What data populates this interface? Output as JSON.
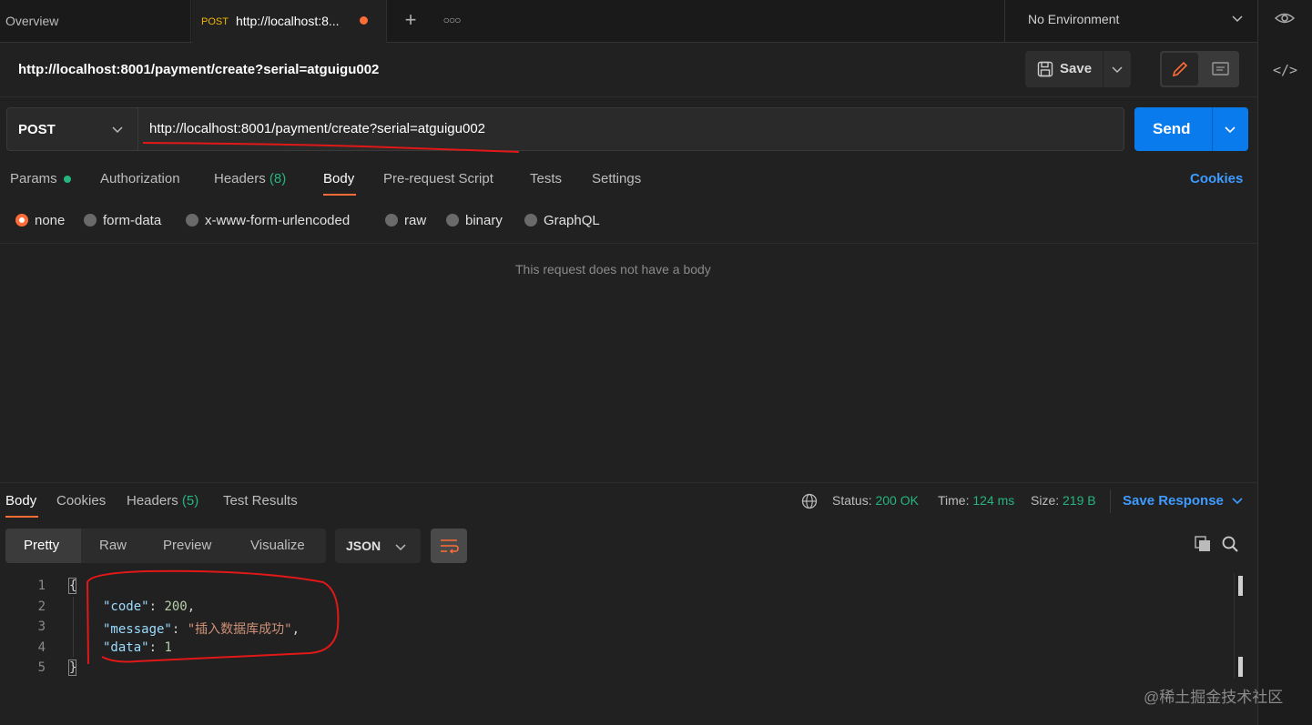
{
  "tabs": {
    "overview": "Overview",
    "active": {
      "method": "POST",
      "label": "http://localhost:8..."
    }
  },
  "environment": "No Environment",
  "request": {
    "title": "http://localhost:8001/payment/create?serial=atguigu002",
    "save_label": "Save",
    "method": "POST",
    "url": "http://localhost:8001/payment/create?serial=atguigu002",
    "send_label": "Send",
    "tabs": {
      "params": "Params",
      "authorization": "Authorization",
      "headers": "Headers",
      "headers_count": "(8)",
      "body": "Body",
      "prerequest": "Pre-request Script",
      "tests": "Tests",
      "settings": "Settings"
    },
    "cookies_label": "Cookies",
    "body_types": [
      "none",
      "form-data",
      "x-www-form-urlencoded",
      "raw",
      "binary",
      "GraphQL"
    ],
    "selected_body_type": "none",
    "no_body_text": "This request does not have a body"
  },
  "response": {
    "tabs": {
      "body": "Body",
      "cookies": "Cookies",
      "headers": "Headers",
      "headers_count": "(5)",
      "test_results": "Test Results"
    },
    "status_label": "Status:",
    "status_value": "200 OK",
    "time_label": "Time:",
    "time_value": "124 ms",
    "size_label": "Size:",
    "size_value": "219 B",
    "save_response_label": "Save Response",
    "views": [
      "Pretty",
      "Raw",
      "Preview",
      "Visualize"
    ],
    "format": "JSON",
    "line_numbers": [
      "1",
      "2",
      "3",
      "4",
      "5"
    ],
    "json": {
      "open": "{",
      "code_key": "\"code\"",
      "code_value": "200",
      "message_key": "\"message\"",
      "message_value": "\"插入数据库成功\"",
      "data_key": "\"data\"",
      "data_value": "1",
      "close": "}"
    }
  },
  "watermark": "@稀土掘金技术社区",
  "colors": {
    "accent": "#ff6c37",
    "send": "#097bed",
    "success": "#26b47f",
    "link": "#3e9bff"
  }
}
